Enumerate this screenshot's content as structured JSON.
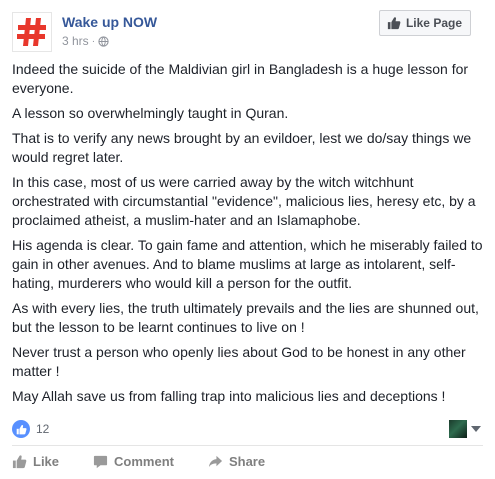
{
  "post": {
    "page_name": "Wake up NOW",
    "time": "3 hrs",
    "separator": "·",
    "like_page_label": "Like Page",
    "paragraphs": [
      "Indeed the suicide of the Maldivian girl in Bangladesh is a huge lesson for everyone.",
      "A lesson so overwhelmingly taught in Quran.",
      "That is to verify any news brought by an evildoer, lest we do/say things we would regret later.",
      "In this case, most of us were carried away by the witch witchhunt orchestrated with circumstantial \"evidence\", malicious lies, heresy etc, by a proclaimed atheist, a muslim-hater and an Islamaphobe.",
      "His agenda is clear. To gain fame and attention, which he miserably failed to gain in other avenues. And to blame muslims at large as intolarent, self-hating, murderers who would kill a person for the outfit.",
      "As with every lies, the truth ultimately prevails and the lies are shunned out, but the lesson to be learnt continues to live on !",
      "Never trust a person who openly lies about God to be honest in any other matter !",
      "May Allah save us from falling trap into malicious lies and deceptions !"
    ],
    "reaction_count": "12",
    "actions": {
      "like": "Like",
      "comment": "Comment",
      "share": "Share"
    }
  },
  "icons": {
    "avatar": "hashtag-logo-icon",
    "privacy": "globe-icon",
    "like_page": "thumbs-up-icon",
    "reaction": "like-reaction-icon",
    "viewer": "viewer-avatar",
    "menu": "chevron-down-icon",
    "like": "thumbs-up-icon",
    "comment": "comment-icon",
    "share": "share-icon"
  },
  "colors": {
    "page_name": "#365899",
    "avatar_brand": "#e8372c",
    "reaction_blue": "#5890ff",
    "muted_text": "#90949c",
    "action_text": "#7f7f7f"
  }
}
